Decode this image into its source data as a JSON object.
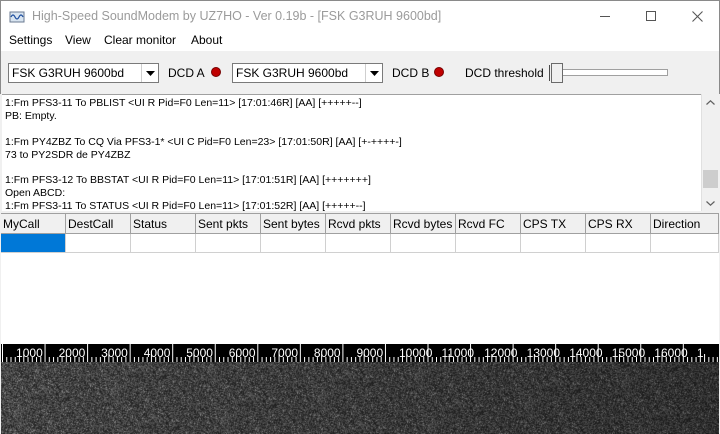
{
  "window": {
    "title": "High-Speed SoundModem by UZ7HO - Ver 0.19b - [FSK G3RUH 9600bd]",
    "icon": "app-icon",
    "controls": [
      "minimize-icon",
      "maximize-icon",
      "close-icon"
    ]
  },
  "menu": {
    "items": [
      {
        "label": "Settings"
      },
      {
        "label": "View"
      },
      {
        "label": "Clear monitor"
      },
      {
        "label": "About"
      }
    ]
  },
  "toolbar": {
    "modem_a": "FSK G3RUH 9600bd",
    "dcd_a_label": "DCD A",
    "modem_b": "FSK G3RUH 9600bd",
    "dcd_b_label": "DCD B",
    "dcd_threshold_label": "DCD threshold",
    "dcd_threshold_value": 0.0,
    "led_color": "#c00000"
  },
  "monitor": {
    "lines": [
      "1:Fm PFS3-11 To PBLIST <UI R Pid=F0 Len=11> [17:01:46R] [AA] [+++++--]",
      "PB: Empty.",
      "",
      "1:Fm PY4ZBZ To CQ Via PFS3-1* <UI C Pid=F0 Len=23> [17:01:50R] [AA] [+-++++-]",
      "73 to PY2SDR de PY4ZBZ",
      "",
      "1:Fm PFS3-12 To BBSTAT <UI R Pid=F0 Len=11> [17:01:51R] [AA] [+++++++]",
      "Open ABCD:",
      "1:Fm PFS3-11 To STATUS <UI R Pid=F0 Len=11> [17:01:52R] [AA] [+++++--]"
    ]
  },
  "grid": {
    "columns": [
      "MyCall",
      "DestCall",
      "Status",
      "Sent pkts",
      "Sent bytes",
      "Rcvd pkts",
      "Rcvd bytes",
      "Rcvd FC",
      "CPS TX",
      "CPS RX",
      "Direction"
    ],
    "selection_color": "#0078d7"
  },
  "spectrum": {
    "ruler_labels": [
      "1000",
      "2000",
      "3000",
      "4000",
      "5000",
      "6000",
      "7000",
      "8000",
      "9000",
      "10000",
      "11000",
      "12000",
      "13000",
      "14000",
      "15000",
      "16000",
      "1"
    ]
  }
}
